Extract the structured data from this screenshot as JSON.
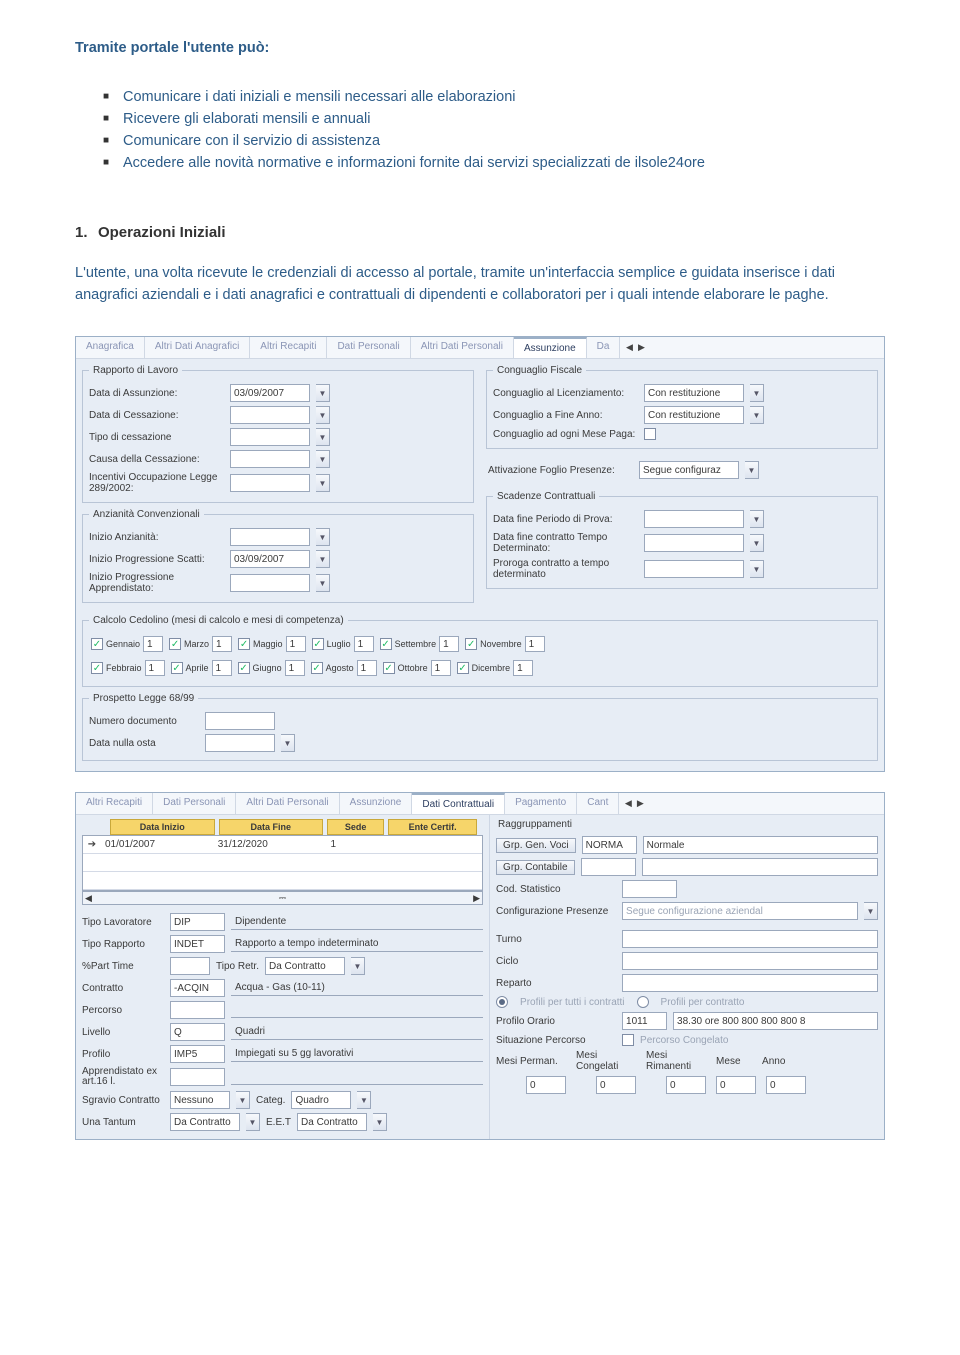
{
  "intro": {
    "title": "Tramite portale l'utente può:",
    "bullets": [
      "Comunicare i dati iniziali e mensili necessari alle elaborazioni",
      "Ricevere gli elaborati mensili e annuali",
      "Comunicare con il servizio di assistenza",
      "Accedere alle novità normative e informazioni fornite dai servizi specializzati de ilsole24ore"
    ]
  },
  "section": {
    "num": "1.",
    "title": "Operazioni Iniziali",
    "para": "L'utente, una volta ricevute le credenziali di accesso al portale, tramite un'interfaccia semplice e guidata inserisce i dati anagrafici aziendali e i dati anagrafici e contrattuali di dipendenti e collaboratori per i quali intende elaborare le paghe."
  },
  "panel1": {
    "tabs": [
      "Anagrafica",
      "Altri Dati Anagrafici",
      "Altri Recapiti",
      "Dati Personali",
      "Altri Dati Personali",
      "Assunzione",
      "Da"
    ],
    "rapporto": {
      "legend": "Rapporto di Lavoro",
      "fields": {
        "assunzione_lbl": "Data di Assunzione:",
        "assunzione_val": "03/09/2007",
        "cessazione_lbl": "Data di Cessazione:",
        "tipo_cess_lbl": "Tipo di cessazione",
        "causa_cess_lbl": "Causa della Cessazione:",
        "incentivi_lbl": "Incentivi Occupazione Legge 289/2002:"
      }
    },
    "conguaglio": {
      "legend": "Conguaglio Fiscale",
      "licenziamento_lbl": "Conguaglio al Licenziamento:",
      "licenziamento_val": "Con restituzione",
      "fineanno_lbl": "Conguaglio a Fine Anno:",
      "fineanno_val": "Con restituzione",
      "mesepaga_lbl": "Conguaglio ad ogni Mese Paga:"
    },
    "foglio": {
      "lbl": "Attivazione Foglio Presenze:",
      "val": "Segue configuraz"
    },
    "anzianita": {
      "legend": "Anzianità Convenzionali",
      "inizio_lbl": "Inizio Anzianità:",
      "scatti_lbl": "Inizio Progressione Scatti:",
      "scatti_val": "03/09/2007",
      "appr_lbl": "Inizio Progressione Apprendistato:"
    },
    "scadenze": {
      "legend": "Scadenze Contrattuali",
      "prova_lbl": "Data fine Periodo di Prova:",
      "tempodet_lbl": "Data fine contratto Tempo Determinato:",
      "proroga_lbl": "Proroga contratto a tempo determinato"
    },
    "calcolo": {
      "legend": "Calcolo Cedolino (mesi di calcolo e mesi di competenza)",
      "months_a": [
        [
          "Gennaio",
          "1"
        ],
        [
          "Marzo",
          "1"
        ],
        [
          "Maggio",
          "1"
        ],
        [
          "Luglio",
          "1"
        ],
        [
          "Settembre",
          "1"
        ],
        [
          "Novembre",
          "1"
        ]
      ],
      "months_b": [
        [
          "Febbraio",
          "1"
        ],
        [
          "Aprile",
          "1"
        ],
        [
          "Giugno",
          "1"
        ],
        [
          "Agosto",
          "1"
        ],
        [
          "Ottobre",
          "1"
        ],
        [
          "Dicembre",
          "1"
        ]
      ]
    },
    "prospetto": {
      "legend": "Prospetto Legge 68/99",
      "numdoc_lbl": "Numero documento",
      "nullaosta_lbl": "Data nulla osta"
    }
  },
  "panel2": {
    "tabs": [
      "Altri Recapiti",
      "Dati Personali",
      "Altri Dati Personali",
      "Assunzione",
      "Dati Contrattuali",
      "Pagamento",
      "Cant"
    ],
    "ycols": [
      "Data Inizio",
      "Data Fine",
      "Sede",
      "Ente Certif."
    ],
    "row": {
      "di": "01/01/2007",
      "df": "31/12/2020",
      "sede": "1",
      "ente": ""
    },
    "left": {
      "tipo_lav": {
        "lbl": "Tipo Lavoratore",
        "code": "DIP",
        "desc": "Dipendente"
      },
      "tipo_rap": {
        "lbl": "Tipo Rapporto",
        "code": "INDET",
        "desc": "Rapporto a tempo indeterminato"
      },
      "pct": {
        "lbl": "%Part Time",
        "code": "",
        "tr_lbl": "Tipo Retr.",
        "tr_val": "Da Contratto"
      },
      "contratto": {
        "lbl": "Contratto",
        "code": "-ACQIN",
        "desc": "Acqua - Gas (10-11)"
      },
      "percorso": {
        "lbl": "Percorso"
      },
      "livello": {
        "lbl": "Livello",
        "code": "Q",
        "desc": "Quadri"
      },
      "profilo": {
        "lbl": "Profilo",
        "code": "IMP5",
        "desc": "Impiegati su 5 gg lavorativi"
      },
      "apprendistato": {
        "lbl": "Apprendistato ex art.16 l."
      },
      "sgravio": {
        "lbl": "Sgravio Contratto",
        "code": "Nessuno",
        "categ_lbl": "Categ.",
        "categ_val": "Quadro"
      },
      "una": {
        "lbl": "Una Tantum",
        "code": "Da Contratto",
        "eet_lbl": "E.E.T",
        "eet_val": "Da Contratto"
      }
    },
    "right": {
      "raggruppamenti": "Raggruppamenti",
      "grp_voci_btn": "Grp. Gen. Voci",
      "grp_voci_code": "NORMA",
      "grp_voci_desc": "Normale",
      "grp_cont_btn": "Grp. Contabile",
      "cod_stat": "Cod. Statistico",
      "conf_presenze_lbl": "Configurazione Presenze",
      "conf_presenze_val": "Segue configurazione aziendal",
      "turno": "Turno",
      "ciclo": "Ciclo",
      "reparto": "Reparto",
      "radio1": "Profili per tutti i contratti",
      "radio2": "Profili per contratto",
      "profilo_orario_lbl": "Profilo Orario",
      "profilo_orario_code": "1011",
      "profilo_orario_desc": "38.30 ore 800 800 800 800 8",
      "sit_percorso": "Situazione Percorso",
      "pc_lbl": "Percorso Congelato",
      "mesi_perman": "Mesi Perman.",
      "mesi_cong": "Mesi Congelati",
      "mesi_rim": "Mesi Rimanenti",
      "mese": "Mese",
      "anno": "Anno",
      "val0": "0"
    }
  }
}
